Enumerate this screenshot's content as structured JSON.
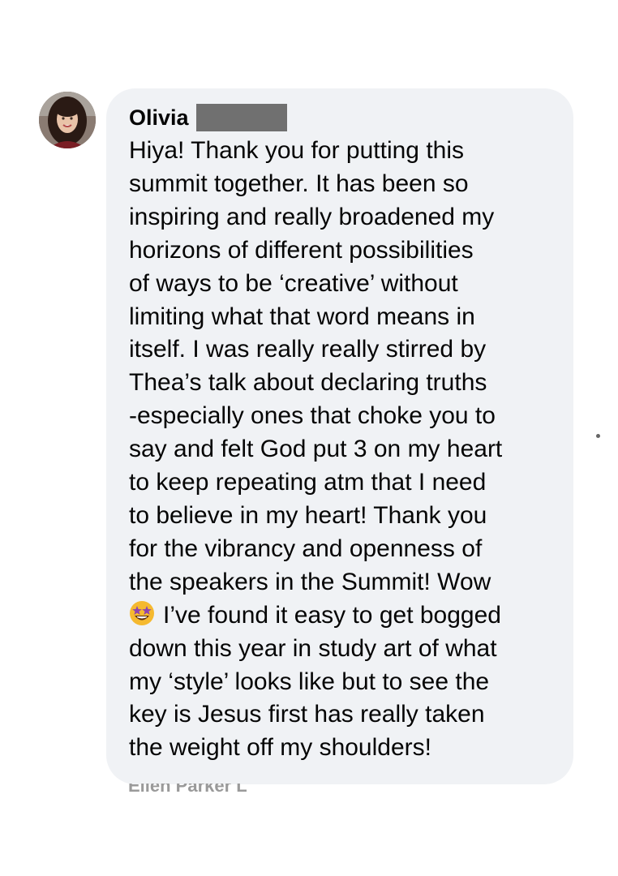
{
  "comment": {
    "author": "Olivia",
    "author_redacted": true,
    "text_before_emoji": "Hiya! Thank you for putting this\nsummit together. It has been so\ninspiring and really broadened my\nhorizons of different possibilities\nof ways to be ‘creative’ without\nlimiting what that word means in\nitself. I was really really stirred by\nThea’s talk about declaring truths\n-especially ones that choke you to\nsay and felt God put 3 on my heart\nto keep repeating atm that I need\nto believe in my heart! Thank you\nfor the vibrancy and openness of\nthe speakers in the Summit! Wow\n",
    "emoji": "star-struck-emoji",
    "text_after_emoji": "I’ve found it easy to get bogged\ndown this year in study art of what\nmy ‘style’ looks like but to see the\nkey is Jesus first has really taken\nthe weight off my shoulders!"
  },
  "next_comment_peek": {
    "author_partial": "Ellen Parker L"
  },
  "colors": {
    "bubble_background": "#f0f2f5",
    "text": "#050505",
    "redaction": "#707070",
    "emoji_face": "#f5b92f",
    "emoji_star": "#8e44ad"
  }
}
